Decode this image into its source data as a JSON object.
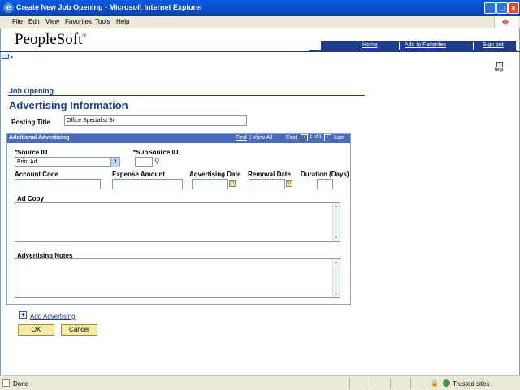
{
  "window": {
    "title": "Create New Job Opening - Microsoft Internet Explorer",
    "minimize": "_",
    "maximize": "□",
    "close": "×"
  },
  "menu": [
    "File",
    "Edit",
    "View",
    "Favorites",
    "Tools",
    "Help"
  ],
  "header": {
    "logo": "PeopleSoft",
    "logo_mark": "®",
    "nav_links": [
      "Home",
      "Add to Favorites",
      "Sign out"
    ],
    "help_label": "help"
  },
  "page": {
    "breadcrumb": "Job Opening",
    "title": "Advertising Information",
    "posting_title_label": "Posting Title",
    "posting_title_value": "Office Specialist Sr"
  },
  "grid": {
    "title": "Additional Advertising",
    "find": "Find",
    "separator": "|",
    "view_all": "View All",
    "first": "First",
    "position": "1 of 1",
    "last": "Last",
    "fields": {
      "source_id_label": "*Source ID",
      "source_id_value": "Print Ad",
      "subsource_id_label": "*SubSource ID",
      "subsource_id_value": "",
      "account_code_label": "Account Code",
      "expense_amount_label": "Expense Amount",
      "advertising_date_label": "Advertising Date",
      "removal_date_label": "Removal Date",
      "duration_label": "Duration (Days)",
      "ad_copy_label": "Ad Copy",
      "advertising_notes_label": "Advertising Notes"
    }
  },
  "actions": {
    "add_advertising": "Add Advertising",
    "ok": "OK",
    "cancel": "Cancel"
  },
  "status": {
    "text": "Done",
    "zone": "Trusted sites"
  }
}
